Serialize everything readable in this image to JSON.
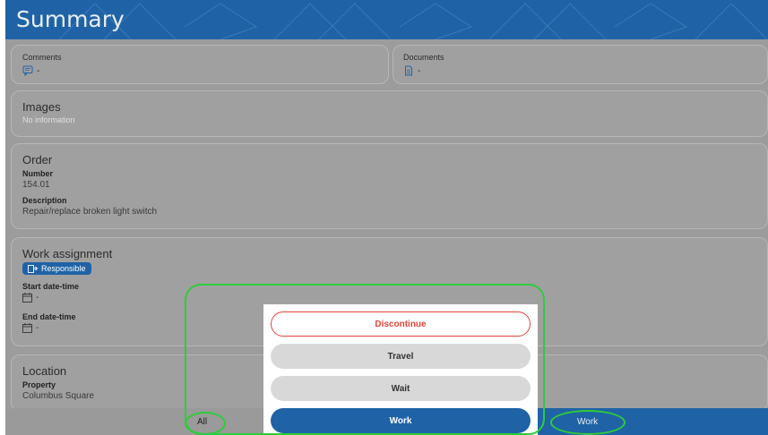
{
  "header": {
    "title": "Summary"
  },
  "comments": {
    "label": "Comments",
    "value": "-",
    "icon": "comment-icon"
  },
  "documents": {
    "label": "Documents",
    "value": "-",
    "icon": "document-icon"
  },
  "images": {
    "heading": "Images",
    "empty_text": "No information"
  },
  "order": {
    "heading": "Order",
    "number_label": "Number",
    "number_value": "154.01",
    "description_label": "Description",
    "description_value": "Repair/replace broken light switch"
  },
  "work_assignment": {
    "heading": "Work assignment",
    "badge": "Responsible",
    "start_label": "Start date-time",
    "start_value": "-",
    "end_label": "End date-time",
    "end_value": "-"
  },
  "location": {
    "heading": "Location",
    "property_label": "Property",
    "property_value": "Columbus Square"
  },
  "bottom_bar": {
    "left_label": "All",
    "right_label": "Work"
  },
  "action_menu": {
    "discontinue": "Discontinue",
    "travel": "Travel",
    "wait": "Wait",
    "work": "Work"
  },
  "colors": {
    "primary": "#1f63a6",
    "danger": "#e0443a",
    "highlight": "#2ecc3a"
  }
}
